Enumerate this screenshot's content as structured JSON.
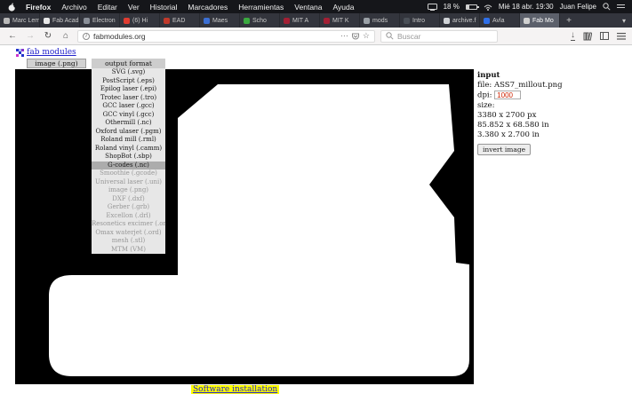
{
  "menubar": {
    "items": [
      "Firefox",
      "Archivo",
      "Editar",
      "Ver",
      "Historial",
      "Marcadores",
      "Herramientas",
      "Ventana",
      "Ayuda"
    ],
    "battery": "18 %",
    "datetime": "Mié 18 abr. 19:30",
    "user": "Juan Felipe"
  },
  "tabbar": {
    "tabs": [
      {
        "label": "Marc Lem",
        "favicon": "#b9b9b9",
        "active": false
      },
      {
        "label": "Fab Acad",
        "favicon": "#e8e8e8",
        "active": false
      },
      {
        "label": "Electron",
        "favicon": "#8a8f98",
        "active": false
      },
      {
        "label": "(6) Hi",
        "favicon": "#e03c31",
        "active": false
      },
      {
        "label": "EAD",
        "favicon": "#c0392b",
        "active": false
      },
      {
        "label": "Maes",
        "favicon": "#3b6fd4",
        "active": false
      },
      {
        "label": "Scho",
        "favicon": "#3aa93f",
        "active": false
      },
      {
        "label": "MIT A",
        "favicon": "#a31f34",
        "active": false
      },
      {
        "label": "MIT K",
        "favicon": "#a31f34",
        "active": false
      },
      {
        "label": "mods",
        "favicon": "#9aa0a6",
        "active": false
      },
      {
        "label": "Intro",
        "favicon": "#4a4f57",
        "active": false
      },
      {
        "label": "archive.f",
        "favicon": "#cfd2d6",
        "active": false
      },
      {
        "label": "Avla",
        "favicon": "#2e6fe8",
        "active": false
      },
      {
        "label": "Fab Mo",
        "favicon": "#d0d0d0",
        "active": true
      }
    ]
  },
  "navbar": {
    "url": "fabmodules.org",
    "search_placeholder": "Buscar"
  },
  "icons": {
    "back": "←",
    "forward": "→",
    "reload": "↻",
    "home": "⌂",
    "info": "i",
    "page_actions": "⋯",
    "star": "☆",
    "download": "↓",
    "new_tab": "+",
    "tab_overflow": "▾"
  },
  "page": {
    "brand": "fab modules",
    "input_format": "image (.png)",
    "output_format_label": "output format",
    "output_options": [
      {
        "label": "SVG (.svg)",
        "state": "normal"
      },
      {
        "label": "PostScript (.eps)",
        "state": "normal"
      },
      {
        "label": "Epilog laser (.epi)",
        "state": "normal"
      },
      {
        "label": "Trotec laser (.tro)",
        "state": "normal"
      },
      {
        "label": "GCC laser (.gcc)",
        "state": "normal"
      },
      {
        "label": "GCC vinyl (.gcc)",
        "state": "normal"
      },
      {
        "label": "Othermill (.nc)",
        "state": "normal"
      },
      {
        "label": "Oxford ulaser (.pgm)",
        "state": "normal"
      },
      {
        "label": "Roland mill (.rml)",
        "state": "normal"
      },
      {
        "label": "Roland vinyl (.camm)",
        "state": "normal"
      },
      {
        "label": "ShopBot (.sbp)",
        "state": "normal"
      },
      {
        "label": "G-codes (.nc)",
        "state": "selected"
      },
      {
        "label": "Smoothie (.gcode)",
        "state": "disabled"
      },
      {
        "label": "Universal laser (.uni)",
        "state": "disabled"
      },
      {
        "label": "image (.png)",
        "state": "disabled"
      },
      {
        "label": "DXF (.dxf)",
        "state": "disabled"
      },
      {
        "label": "Gerber (.grb)",
        "state": "disabled"
      },
      {
        "label": "Excellon (.drl)",
        "state": "disabled"
      },
      {
        "label": "Resonetics excimer (.oms)",
        "state": "disabled"
      },
      {
        "label": "Omax waterjet (.ord)",
        "state": "disabled"
      },
      {
        "label": "mesh (.stl)",
        "state": "disabled"
      },
      {
        "label": "MTM (VM)",
        "state": "disabled"
      }
    ],
    "input_panel": {
      "title": "input",
      "file_label": "file:",
      "file_name": "ASS7_millout.png",
      "dpi_label": "dpi:",
      "dpi_value": "1000",
      "size_label": "size:",
      "size_px": "3380 x 2700 px",
      "size_in": "85.852 x 68.580 in",
      "size_in2": "3.380 x 2.700 in",
      "invert": "invert image"
    },
    "footer_link": "Software installation"
  },
  "colors": {
    "accent_link": "#2222cc",
    "dpi_red": "#cc2200",
    "highlight_yellow": "#ffff00"
  }
}
